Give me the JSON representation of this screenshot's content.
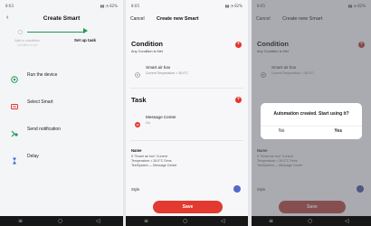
{
  "colors": {
    "accent_green": "#1f9a55",
    "accent_red": "#e3362d",
    "style_blue": "#5767c9"
  },
  "screen1": {
    "status_left": "8:03",
    "status_right": "▮▮ ◔ 82%",
    "title": "Create Smart",
    "steps": [
      {
        "label": "Add a condition",
        "sub": "Condition is set"
      },
      {
        "label": "Set up task"
      }
    ],
    "tasks": [
      {
        "label": "Run the device",
        "icon": "device-icon"
      },
      {
        "label": "Select Smart",
        "icon": "smart-icon"
      },
      {
        "label": "Send notification",
        "icon": "notification-icon"
      },
      {
        "label": "Delay",
        "icon": "hourglass-icon"
      }
    ]
  },
  "screen2": {
    "status_left": "8:05",
    "status_right": "▮▮ ◔ 82%",
    "cancel": "Cancel",
    "title": "Create new Smart",
    "condition_title": "Condition",
    "condition_sub": "Any Condition is Met",
    "condition_item_title": "Smart air box",
    "condition_item_sub": "Current Temperature > 26.0°C",
    "task_title": "Task",
    "task_item_title": "Message Center",
    "task_item_sub": "On",
    "name_label": "Name",
    "name_lines": [
      "If \"Smart air box\" Current",
      "Temperature > 26.0°C Sens",
      "TestSystem — Message Center"
    ],
    "style_label": "Style",
    "save": "Save"
  },
  "screen3": {
    "status_left": "8:05",
    "status_right": "▮▮ ◔ 82%",
    "cancel": "Cancel",
    "title": "Create new Smart",
    "condition_title": "Condition",
    "condition_sub": "Any Condition is Met",
    "condition_item_title": "Smart air box",
    "condition_item_sub": "Current Temperature > 26.0°C",
    "name_label": "Name",
    "name_lines": [
      "If \"Smart air box\" Current",
      "Temperature > 26.0°C Sens",
      "TestSystem — Message Center"
    ],
    "style_label": "Style",
    "save": "Save",
    "dialog_message": "Automation created. Start using it?",
    "dialog_no": "No",
    "dialog_yes": "Yes"
  },
  "navbar": {
    "menu": "≡",
    "home": "○",
    "back": "◁"
  }
}
